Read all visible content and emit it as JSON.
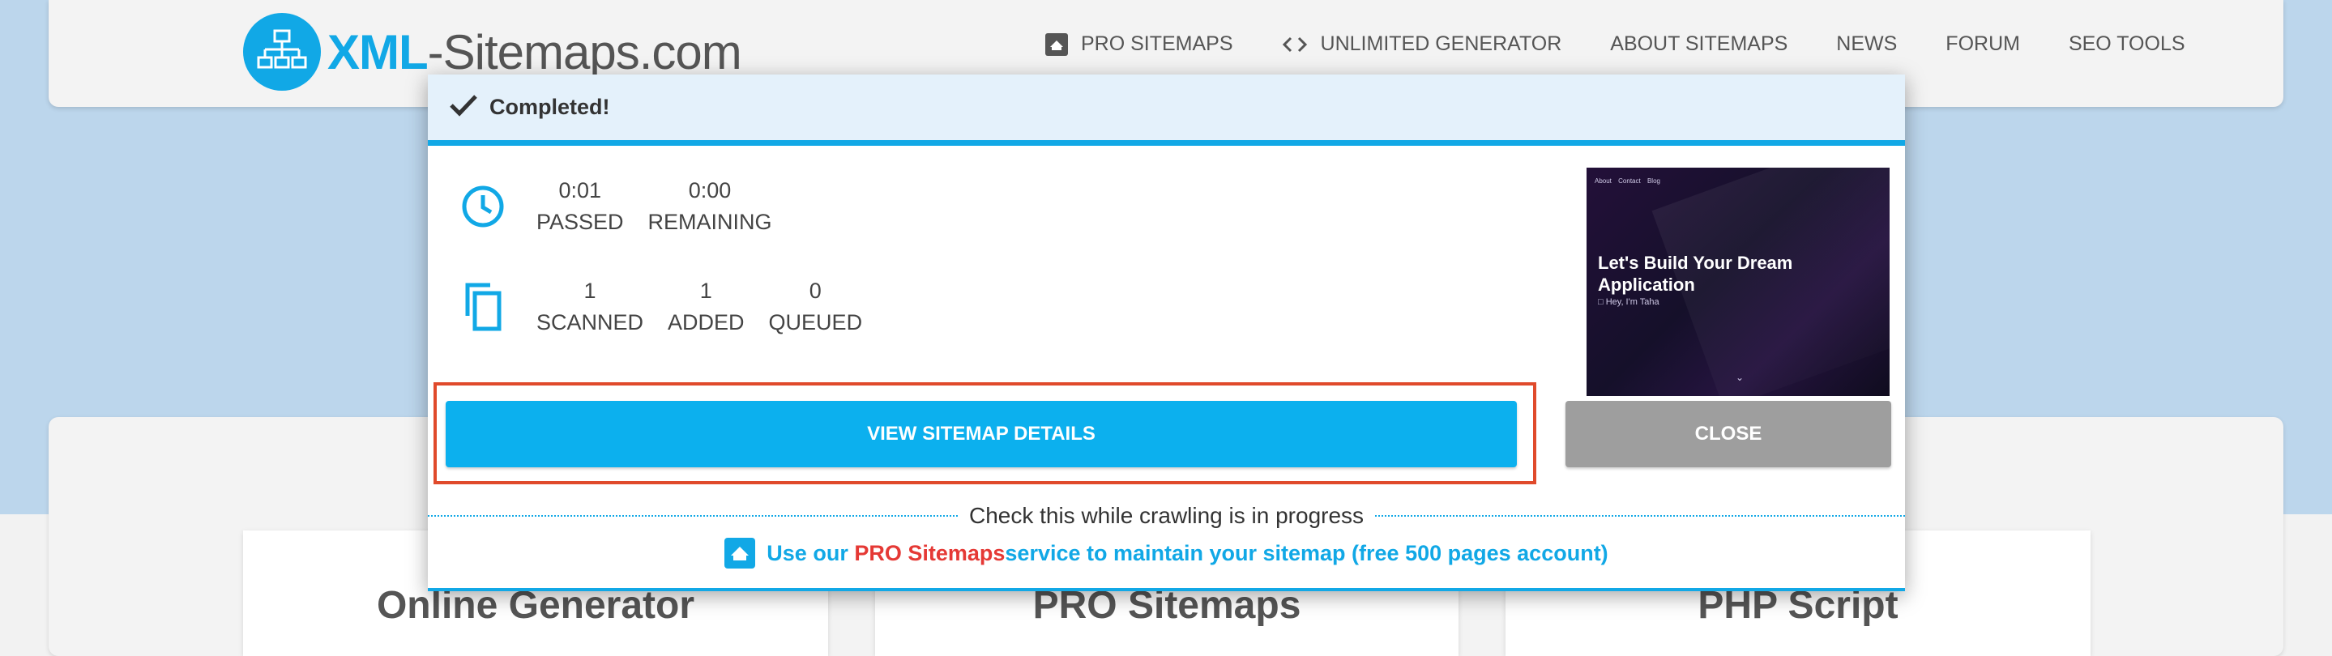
{
  "logo": {
    "xml": "XML",
    "rest": "-Sitemaps.com"
  },
  "nav": [
    {
      "label": "PRO SITEMAPS",
      "icon": "pro-sitemaps-icon"
    },
    {
      "label": "UNLIMITED GENERATOR",
      "icon": "code-icon"
    },
    {
      "label": "ABOUT SITEMAPS"
    },
    {
      "label": "NEWS"
    },
    {
      "label": "FORUM"
    },
    {
      "label": "SEO TOOLS"
    }
  ],
  "cards": [
    {
      "title": "Online Generator"
    },
    {
      "title": "PRO Sitemaps"
    },
    {
      "title": "PHP Script"
    }
  ],
  "modal": {
    "status": "Completed!",
    "time": {
      "passed_value": "0:01",
      "passed_label": "PASSED",
      "remaining_value": "0:00",
      "remaining_label": "REMAINING"
    },
    "pages": {
      "scanned_value": "1",
      "scanned_label": "SCANNED",
      "added_value": "1",
      "added_label": "ADDED",
      "queued_value": "0",
      "queued_label": "QUEUED"
    },
    "preview": {
      "nav": [
        "About",
        "Contact",
        "Blog"
      ],
      "heading": "Let's Build Your Dream Application",
      "subtitle": "□ Hey, I'm Taha",
      "chevron": "⌄"
    },
    "view_button": "VIEW SITEMAP DETAILS",
    "close_button": "CLOSE",
    "divider_text": "Check this while crawling is in progress",
    "promo": {
      "prefix": "Use our ",
      "highlight": "PRO Sitemaps",
      "suffix": " service to maintain your sitemap (free 500 pages account)"
    }
  },
  "colors": {
    "brand": "#11a8e6",
    "highlight_border": "#e04a2b",
    "close_button": "#9e9e9e",
    "promo_red": "#e53935"
  }
}
